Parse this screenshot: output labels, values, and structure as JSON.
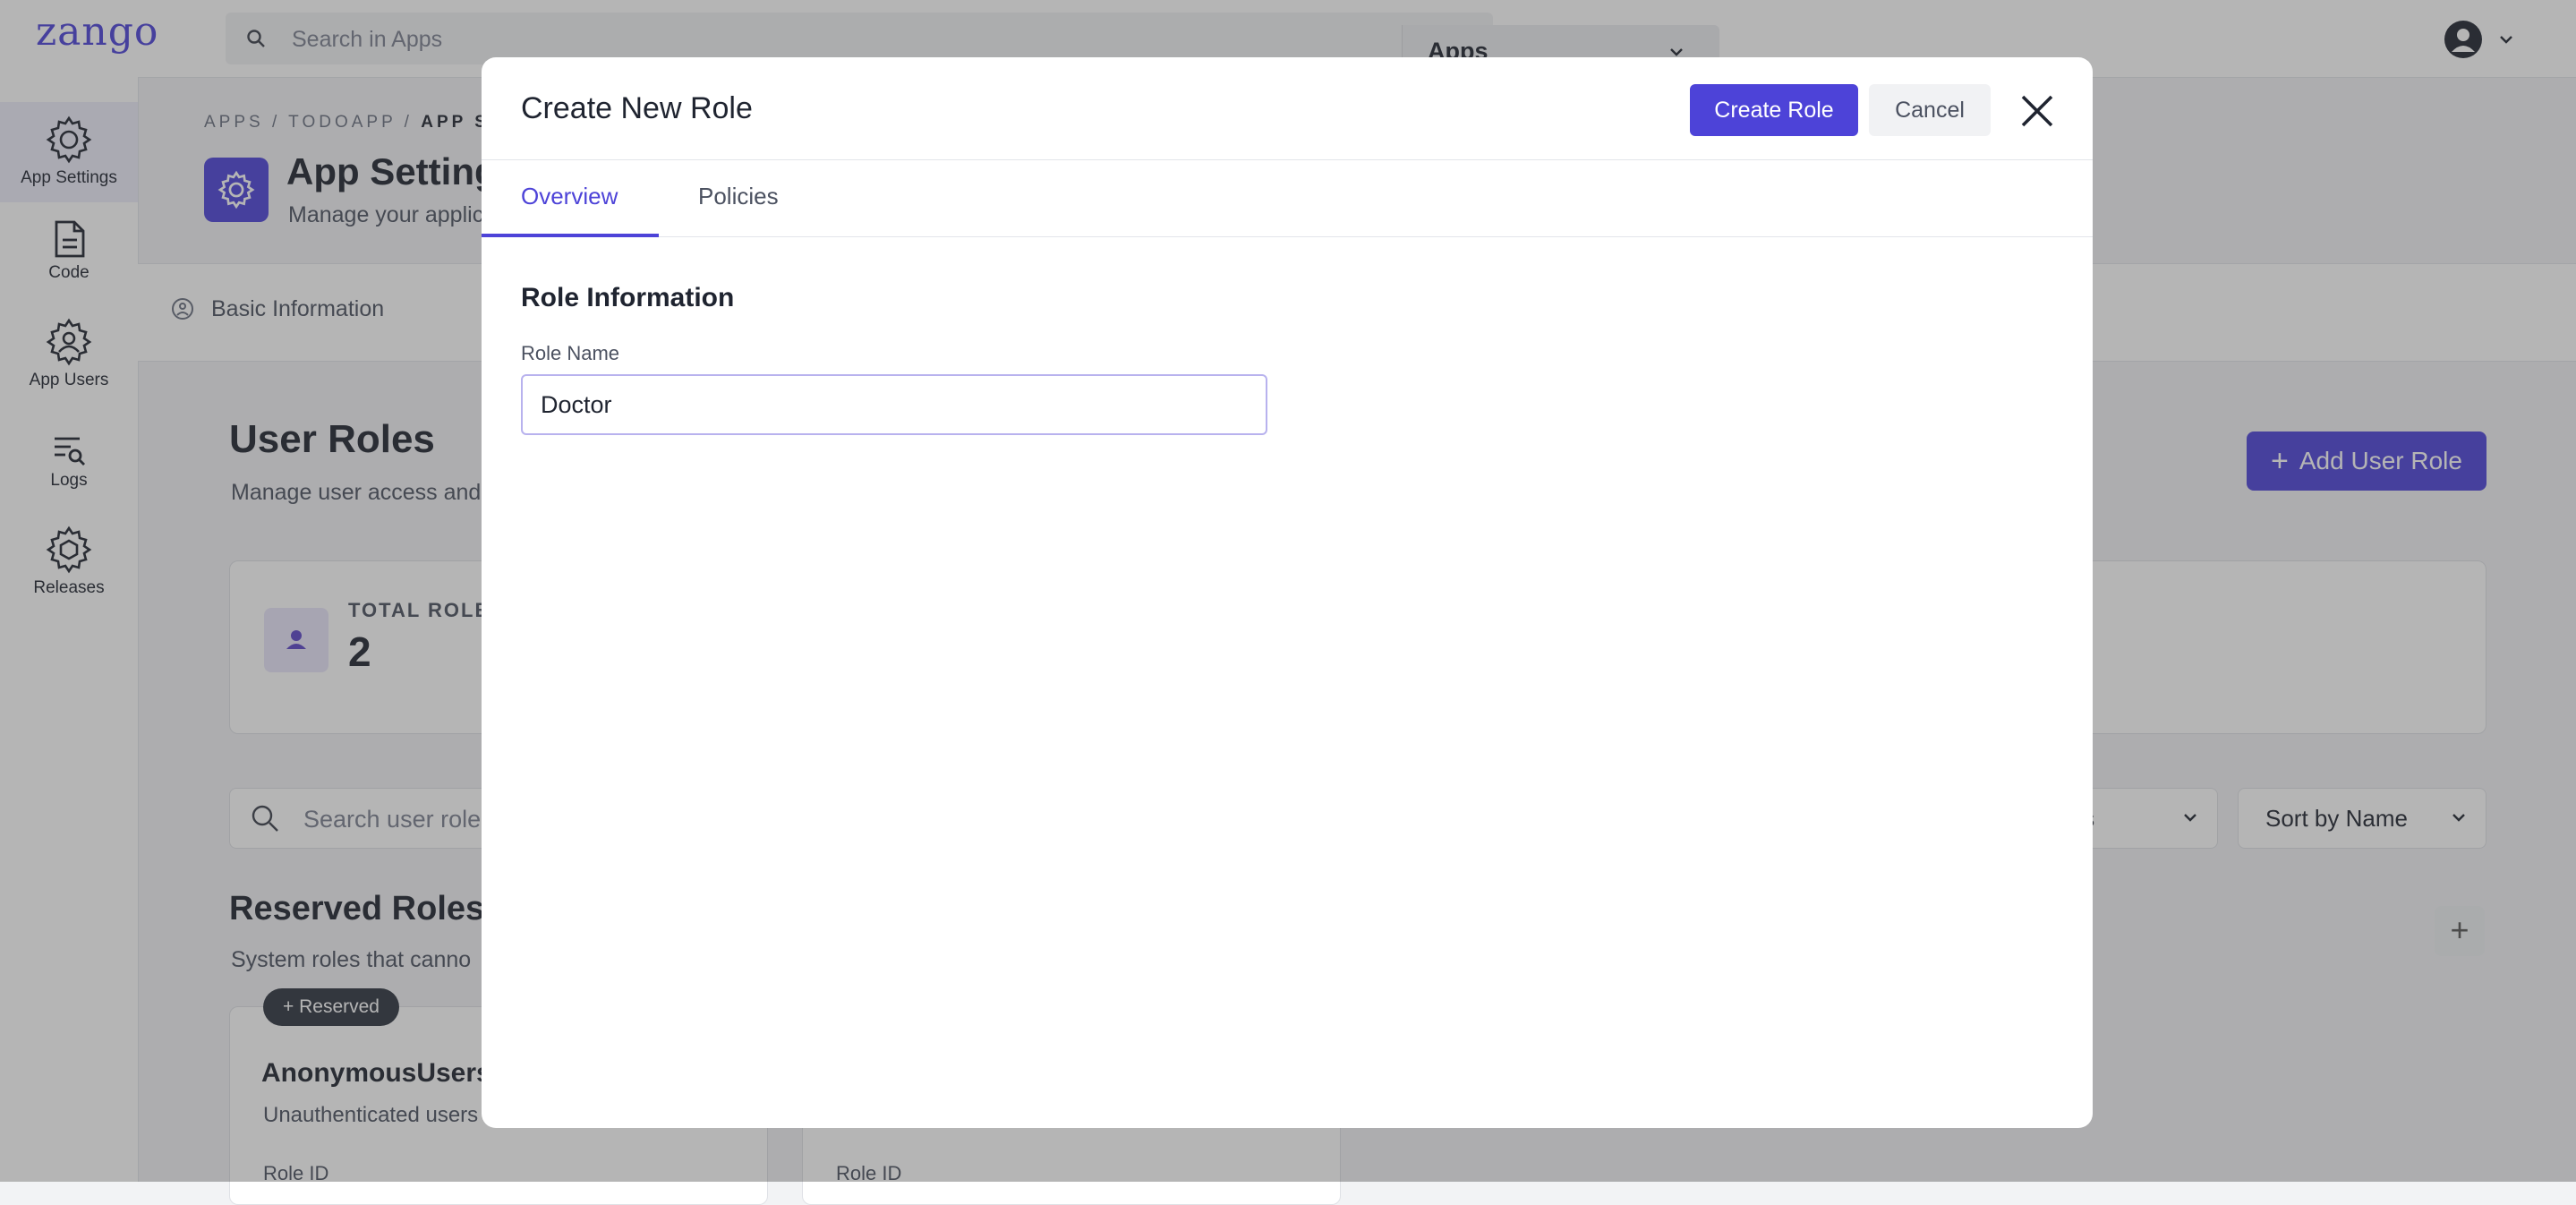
{
  "topbar": {
    "logo": "zango",
    "search_placeholder": "Search in Apps",
    "apps_selected": "Apps"
  },
  "sidebar": {
    "items": [
      {
        "label": "App Settings",
        "icon": "gear-icon",
        "active": true
      },
      {
        "label": "Code",
        "icon": "file-code-icon"
      },
      {
        "label": "App Users",
        "icon": "users-gear-icon"
      },
      {
        "label": "Logs",
        "icon": "logs-icon"
      },
      {
        "label": "Releases",
        "icon": "releases-icon"
      }
    ]
  },
  "page": {
    "breadcrumb_prefix": "APPS / TODOAPP / ",
    "breadcrumb_current": "APP SE",
    "title": "App Setting",
    "subtitle": "Manage your applic",
    "tab_basic": "Basic Information"
  },
  "roles": {
    "title": "User Roles",
    "subtitle": "Manage user access and",
    "add_button": "Add User Role",
    "total_label": "TOTAL ROLES",
    "total_value": "2",
    "search_placeholder": "Search user roles",
    "status_filter": "atus",
    "sort_filter": "Sort by Name"
  },
  "reserved": {
    "title": "Reserved Roles",
    "subtitle": "System roles that canno",
    "badge": "Reserved",
    "cards": [
      {
        "name": "AnonymousUsers",
        "description": "Unauthenticated users",
        "role_id_label": "Role ID"
      },
      {
        "role_id_label": "Role ID"
      }
    ]
  },
  "modal": {
    "title": "Create New Role",
    "create_button": "Create Role",
    "cancel_button": "Cancel",
    "tabs": [
      {
        "label": "Overview",
        "active": true
      },
      {
        "label": "Policies",
        "active": false
      }
    ],
    "section_title": "Role Information",
    "role_name_label": "Role Name",
    "role_name_value": "Doctor"
  },
  "colors": {
    "accent": "#4d43d8",
    "overlay": "rgba(60,60,60,0.38)"
  }
}
